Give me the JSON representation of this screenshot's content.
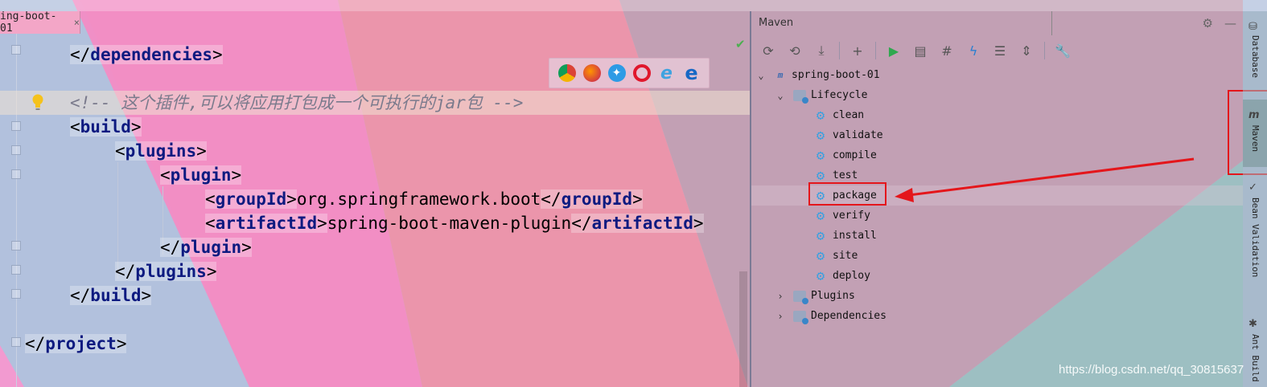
{
  "editor": {
    "tab_label": "ing-boot-01",
    "tab_close": "×",
    "code": {
      "dependencies_close": "dependencies",
      "comment": "<!-- 这个插件,可以将应用打包成一个可执行的jar包 -->",
      "build": "build",
      "plugins": "plugins",
      "plugin": "plugin",
      "groupId_tag": "groupId",
      "groupId_value": "org.springframework.boot",
      "artifactId_tag": "artifactId",
      "artifactId_value": "spring-boot-maven-plugin",
      "project": "project"
    },
    "browser_icons": [
      "chrome-icon",
      "firefox-icon",
      "safari-icon",
      "opera-icon",
      "ie-icon",
      "edge-icon"
    ]
  },
  "maven": {
    "title": "Maven",
    "toolbar_icons": [
      "reload-icon",
      "generate-sources-icon",
      "download-icon",
      "add-icon",
      "run-icon",
      "run-config-icon",
      "toggle-offline-icon",
      "skip-tests-icon",
      "show-dependencies-icon",
      "collapse-all-icon",
      "settings-wrench-icon"
    ],
    "tree": {
      "project": "spring-boot-01",
      "lifecycle": "Lifecycle",
      "phases": [
        "clean",
        "validate",
        "compile",
        "test",
        "package",
        "verify",
        "install",
        "site",
        "deploy"
      ],
      "selected_phase": "package",
      "plugins": "Plugins",
      "dependencies": "Dependencies"
    }
  },
  "side_strip": {
    "database": "Database",
    "maven": "Maven",
    "bean_validation": "Bean Validation",
    "ant_build": "Ant Build"
  },
  "watermark": "https://blog.csdn.net/qq_30815637",
  "colors": {
    "highlight": "#e4161b",
    "tag": "#0d1a80",
    "gear": "#3aa0e0"
  }
}
